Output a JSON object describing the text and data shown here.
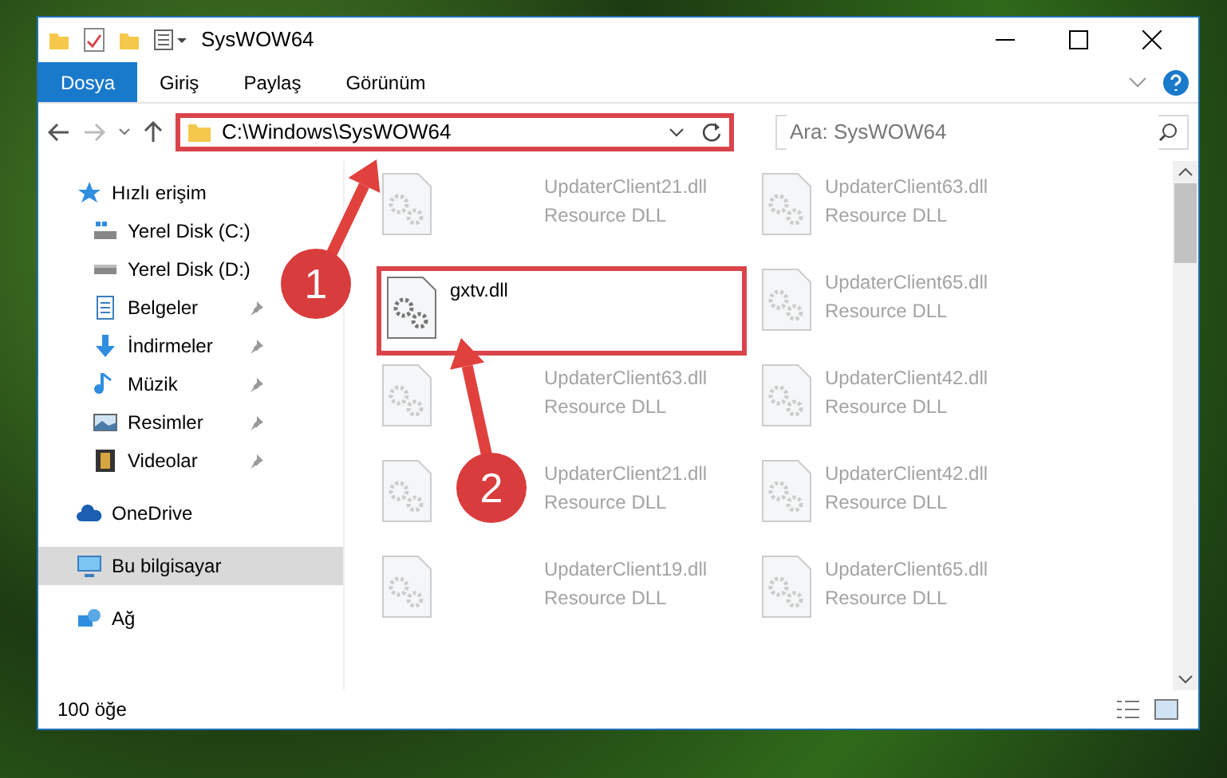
{
  "window": {
    "title": "SysWOW64"
  },
  "ribbon": {
    "tabs": [
      {
        "label": "Dosya",
        "kind": "file",
        "selected": false
      },
      {
        "label": "Giriş",
        "kind": "tab",
        "selected": false
      },
      {
        "label": "Paylaş",
        "kind": "tab",
        "selected": false
      },
      {
        "label": "Görünüm",
        "kind": "tab",
        "selected": false
      }
    ]
  },
  "address_bar": {
    "path": "C:\\Windows\\SysWOW64",
    "highlighted": true
  },
  "search": {
    "placeholder": "Ara: SysWOW64"
  },
  "sidebar": {
    "items": [
      {
        "label": "Hızlı erişim",
        "kind": "star",
        "selected": false,
        "children": [
          {
            "label": "Yerel Disk (C:)",
            "kind": "windrive",
            "pinned": false,
            "selected": false
          },
          {
            "label": "Yerel Disk (D:)",
            "kind": "drive",
            "pinned": false,
            "selected": false
          },
          {
            "label": "Belgeler",
            "kind": "document",
            "pinned": true,
            "selected": false
          },
          {
            "label": "İndirmeler",
            "kind": "download",
            "pinned": true,
            "selected": false
          },
          {
            "label": "Müzik",
            "kind": "music",
            "pinned": true,
            "selected": false
          },
          {
            "label": "Resimler",
            "kind": "picture",
            "pinned": true,
            "selected": false
          },
          {
            "label": "Videolar",
            "kind": "video",
            "pinned": true,
            "selected": false
          }
        ]
      },
      {
        "label": "OneDrive",
        "kind": "cloud",
        "selected": false
      },
      {
        "label": "Bu bilgisayar",
        "kind": "computer",
        "selected": true
      },
      {
        "label": "Ağ",
        "kind": "network",
        "selected": false
      }
    ]
  },
  "files": [
    {
      "name": "UpdaterClient21.dll",
      "type": "Resource DLL",
      "kind": "faded"
    },
    {
      "name": "UpdaterClient63.dll",
      "type": "Resource DLL",
      "kind": "faded"
    },
    {
      "name": "gxtv.dll",
      "kind": "highlight"
    },
    {
      "name": "UpdaterClient65.dll",
      "type": "Resource DLL",
      "kind": "faded"
    },
    {
      "name": "UpdaterClient63.dll",
      "type": "Resource DLL",
      "kind": "faded"
    },
    {
      "name": "UpdaterClient42.dll",
      "type": "Resource DLL",
      "kind": "faded"
    },
    {
      "name": "UpdaterClient21.dll",
      "type": "Resource DLL",
      "kind": "faded"
    },
    {
      "name": "UpdaterClient42.dll",
      "type": "Resource DLL",
      "kind": "faded"
    },
    {
      "name": "UpdaterClient19.dll",
      "type": "Resource DLL",
      "kind": "faded"
    },
    {
      "name": "UpdaterClient65.dll",
      "type": "Resource DLL",
      "kind": "faded"
    }
  ],
  "status_bar": {
    "count": "100 öğe"
  },
  "annotations": [
    {
      "number": "1"
    },
    {
      "number": "2"
    }
  ]
}
